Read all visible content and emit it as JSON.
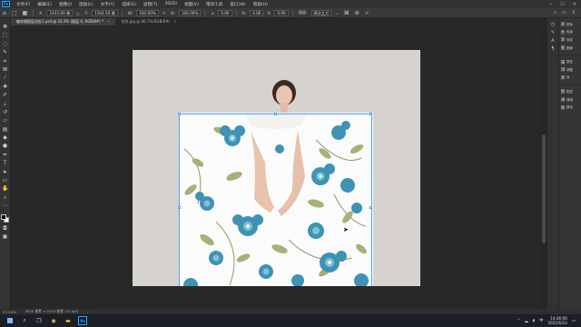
{
  "app": {
    "name": "Ps"
  },
  "menu": [
    "文件(F)",
    "编辑(E)",
    "图像(I)",
    "图层(L)",
    "文字(Y)",
    "选择(S)",
    "滤镜(T)",
    "3D(D)",
    "视图(V)",
    "增效工具",
    "窗口(W)",
    "帮助(H)"
  ],
  "options": {
    "x_label": "X:",
    "x_value": "1433.00 像",
    "y_label": "Y:",
    "y_value": "1164.50 像",
    "w_label": "W:",
    "w_value": "100.00%",
    "h_label": "H:",
    "h_value": "100.00%",
    "angle_value": "0.00",
    "hskew_label": "H:",
    "hskew_value": "0.00",
    "vskew_label": "V:",
    "vskew_value": "0.00",
    "interp_label": "插值:",
    "interp_value": "两次立方"
  },
  "tabs": [
    {
      "label": "编衣服图层化处1.psd @ 33.3% (图层 6, RGB/8#) *",
      "close": "×"
    },
    {
      "label": "花纹.jpg @ 66.7%(RGB/8#)",
      "close": "×"
    }
  ],
  "panels": [
    {
      "icon": "颜",
      "label": "颜色"
    },
    {
      "icon": "色",
      "label": "色板"
    },
    {
      "icon": "渐",
      "label": "渐变"
    },
    {
      "icon": "图",
      "label": "图案"
    },
    {
      "icon": "属",
      "label": "属性"
    },
    {
      "icon": "调",
      "label": "调整"
    },
    {
      "icon": "库",
      "label": "库"
    },
    {
      "icon": "图",
      "label": "图层"
    },
    {
      "icon": "通",
      "label": "通道"
    },
    {
      "icon": "路",
      "label": "路径"
    }
  ],
  "status": {
    "zoom": "33.33%",
    "doc": "2835 像素 × 2245 像素 (72 ppi)"
  },
  "taskbar": {
    "ime": "中",
    "time": "14:36:00",
    "date": "2021/6/23"
  },
  "colors": {
    "accent": "#31a8ff",
    "flower_blue": "#3f92b3",
    "leaf_green": "#a6b07a",
    "doc_bg": "#d6d2cd"
  }
}
